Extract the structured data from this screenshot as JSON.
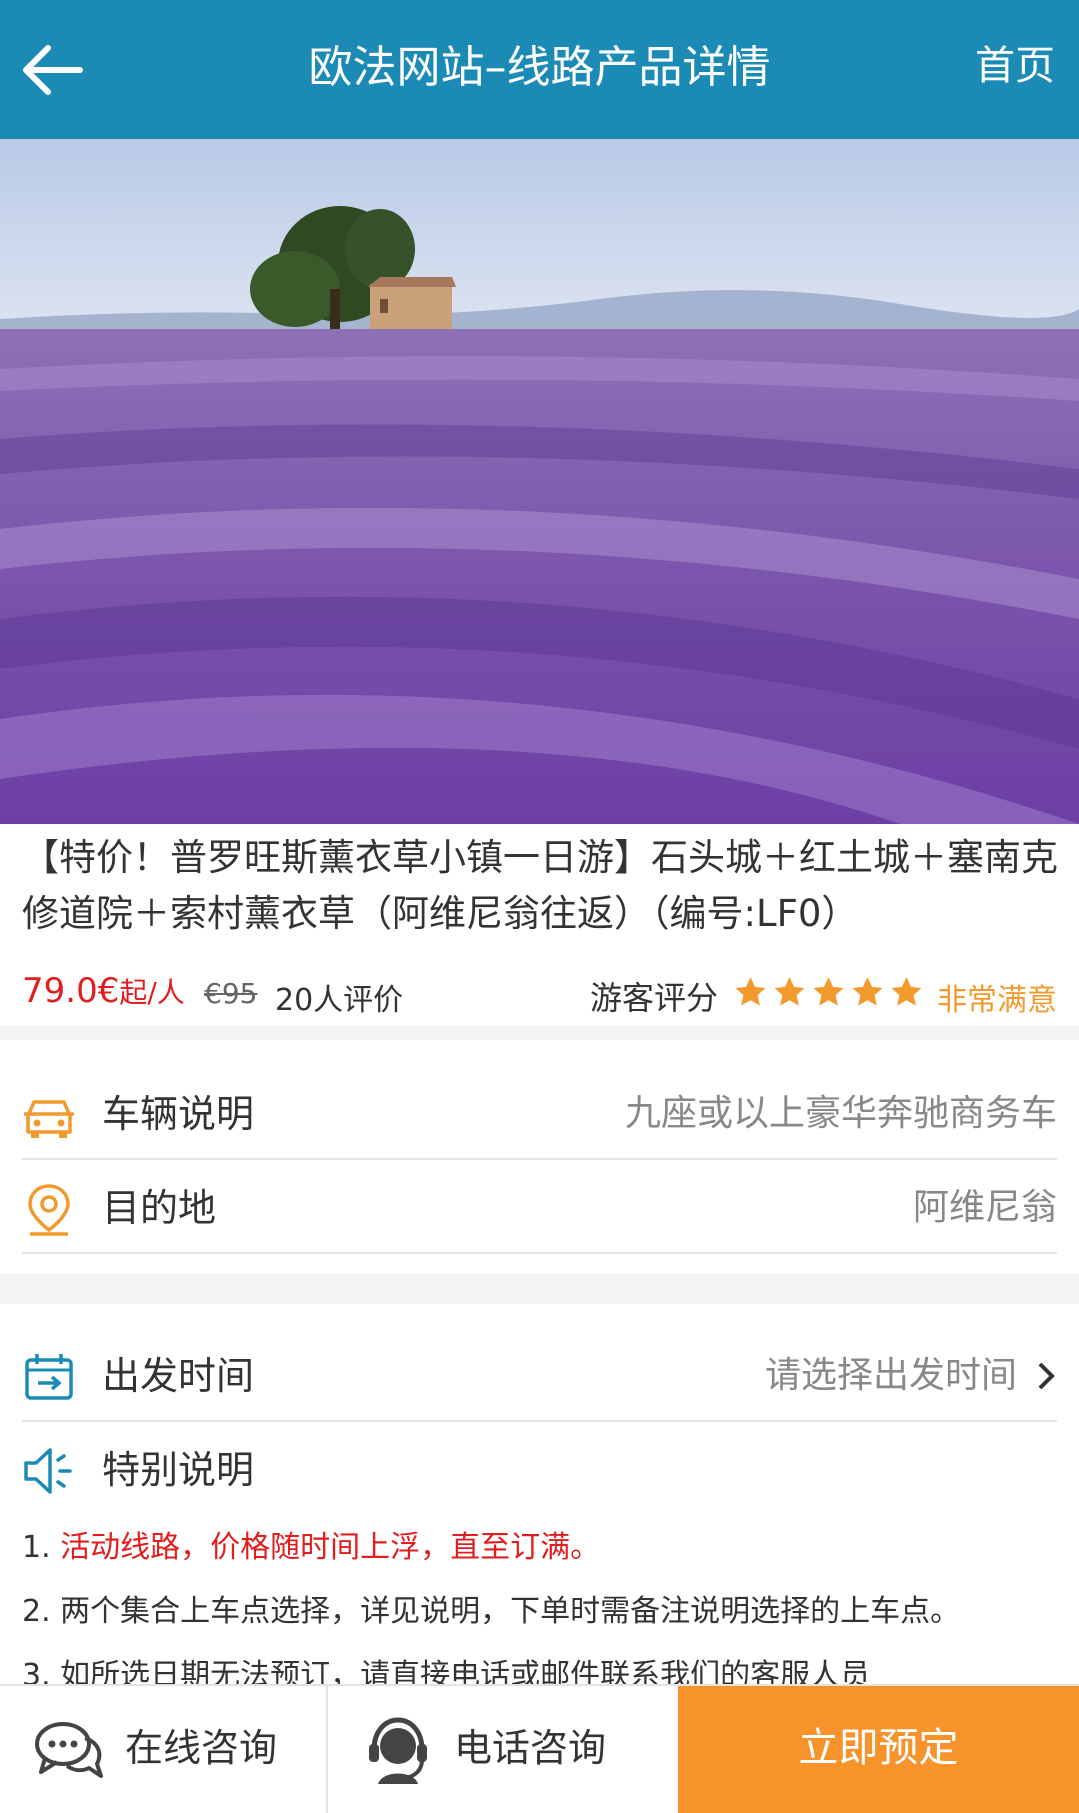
{
  "header": {
    "back_icon": "arrow-left-icon",
    "title": "欧法网站–线路产品详情",
    "home_label": "首页",
    "bg_color": "#1b8bb6"
  },
  "hero": {
    "image": "lavender-field-photo"
  },
  "product": {
    "title": "【特价！普罗旺斯薰衣草小镇一日游】石头城＋红土城＋塞南克修道院＋索村薰衣草（阿维尼翁往返）（编号:LF0）",
    "price": "79.0€",
    "price_unit": "起/人",
    "old_price": "€95",
    "reviews": "20人评价",
    "rating_label": "游客评分",
    "rating_stars": 5,
    "rating_text": "非常满意"
  },
  "info": {
    "vehicle": {
      "icon": "car-icon",
      "label": "车辆说明",
      "value": "九座或以上豪华奔驰商务车"
    },
    "destination": {
      "icon": "location-pin-icon",
      "label": "目的地",
      "value": "阿维尼翁"
    }
  },
  "departure": {
    "icon": "calendar-icon",
    "label": "出发时间",
    "value": "请选择出发时间",
    "chevron": "chevron-right-icon"
  },
  "special": {
    "icon": "speaker-icon",
    "label": "特别说明"
  },
  "notes": [
    {
      "num": "1.",
      "text": "活动线路，价格随时间上浮，直至订满。"
    },
    {
      "num": "2.",
      "text": "两个集合上车点选择，详见说明，下单时需备注说明选择的上车点。"
    },
    {
      "num": "3.",
      "text": "如所选日期无法预订，请直接电话或邮件联系我们的客服人员"
    }
  ],
  "footer": {
    "online": {
      "icon": "chat-bubbles-icon",
      "label": "在线咨询"
    },
    "phone": {
      "icon": "headset-icon",
      "label": "电话咨询"
    },
    "book": {
      "label": "立即预定",
      "color": "#f7932b"
    }
  },
  "colors": {
    "accent": "#f29a2e",
    "price": "#e01e1e",
    "icon_blue": "#1b8bb6"
  }
}
